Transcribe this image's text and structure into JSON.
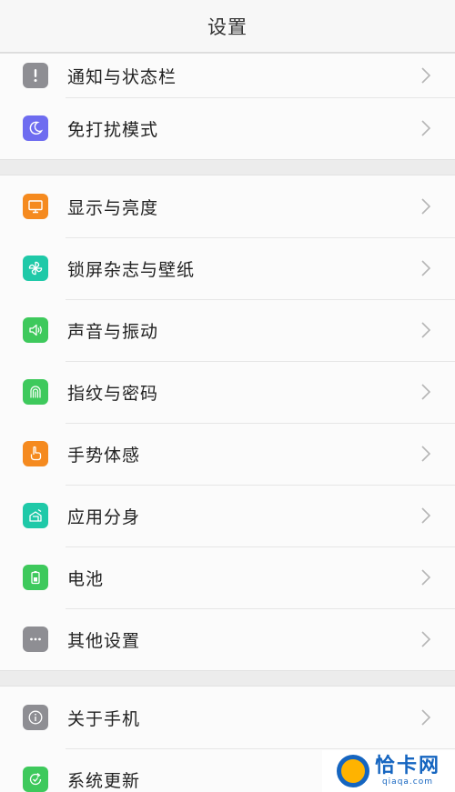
{
  "header": {
    "title": "设置"
  },
  "groups": [
    {
      "items": [
        {
          "label": "通知与状态栏",
          "icon": "exclamation-icon",
          "color": "#8e8e93"
        },
        {
          "label": "免打扰模式",
          "icon": "moon-icon",
          "color": "#6e6cf0"
        }
      ]
    },
    {
      "items": [
        {
          "label": "显示与亮度",
          "icon": "monitor-icon",
          "color": "#f58a1f"
        },
        {
          "label": "锁屏杂志与壁纸",
          "icon": "pinwheel-icon",
          "color": "#1fc9a8"
        },
        {
          "label": "声音与振动",
          "icon": "speaker-icon",
          "color": "#3ec95c"
        },
        {
          "label": "指纹与密码",
          "icon": "fingerprint-icon",
          "color": "#3ec95c"
        },
        {
          "label": "手势体感",
          "icon": "hand-pointer-icon",
          "color": "#f58a1f"
        },
        {
          "label": "应用分身",
          "icon": "app-clone-icon",
          "color": "#1fc9a8"
        },
        {
          "label": "电池",
          "icon": "battery-icon",
          "color": "#3ec95c"
        },
        {
          "label": "其他设置",
          "icon": "more-dots-icon",
          "color": "#8e8e93"
        }
      ]
    },
    {
      "items": [
        {
          "label": "关于手机",
          "icon": "info-icon",
          "color": "#8e8e93"
        },
        {
          "label": "系统更新",
          "icon": "update-icon",
          "color": "#3ec95c"
        }
      ]
    }
  ],
  "watermark": {
    "main": "恰卡网",
    "sub": "qiaqa.com"
  }
}
